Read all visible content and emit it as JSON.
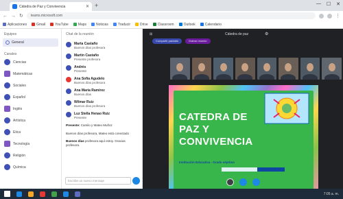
{
  "browser": {
    "tab_title": "Cátedra de Paz y Convivencia",
    "url": "teams.microsoft.com",
    "bookmarks": [
      "Aplicaciones",
      "Gmail",
      "YouTube",
      "Maps",
      "Noticias",
      "Traducir",
      "Drive",
      "Classroom",
      "Outlook",
      "Calendario"
    ],
    "bookmark_colors": [
      "#5c6bc0",
      "#d93025",
      "#d93025",
      "#34a853",
      "#4285f4",
      "#4285f4",
      "#fbbc04",
      "#188038",
      "#0078d4",
      "#1a73e8"
    ]
  },
  "sidebar": {
    "section_label": "Equipos",
    "active_item": "General",
    "channels_label": "Canales",
    "channels": [
      "Ciencias",
      "Matemáticas",
      "Sociales",
      "Español",
      "Inglés",
      "Artística",
      "Ética",
      "Tecnología",
      "Religión",
      "Química"
    ]
  },
  "chat": {
    "header": "Chat de la reunión",
    "messages": [
      {
        "name": "Marta Castaño",
        "text": "Buenos días profesora"
      },
      {
        "name": "Martín Castaño",
        "text": "Presente profesora"
      },
      {
        "name": "Andrés",
        "text": "Presente"
      },
      {
        "name": "Ana Sofía Agudelo",
        "text": "Buenos días profesora"
      },
      {
        "name": "Ana María Ramírez",
        "text": "Buenos días"
      },
      {
        "name": "Wilmar Ruiz",
        "text": "Buenos días profesora"
      },
      {
        "name": "Luz Stella Henao Ruiz",
        "text": "Presente"
      }
    ],
    "notes": [
      {
        "bold": "Presente:",
        "text": "Camilo y Mateo Muñoz"
      },
      {
        "bold": "",
        "text": "Buenos días profesora, Mateo está conectado"
      },
      {
        "bold": "Buenos días",
        "text": "profesora aquí estoy. Gracias profesora."
      }
    ],
    "compose_placeholder": "Escribe un nuevo mensaje"
  },
  "meeting": {
    "title": "Cátedra de paz",
    "chips": [
      "Compartir pantalla",
      "Grabar reunión"
    ],
    "participant_count": 8,
    "slide": {
      "title_lines": [
        "CATEDRA DE",
        "PAZ Y",
        "CONVIVENCIA"
      ],
      "subtitle": "Institución Educativa - Grado séptimo"
    }
  },
  "taskbar": {
    "clock": "7:05 a. m.",
    "icons": [
      "#1e88e5",
      "#f9a825",
      "#e53935",
      "#43a047",
      "#1e88e5",
      "#5c6bc0"
    ]
  }
}
